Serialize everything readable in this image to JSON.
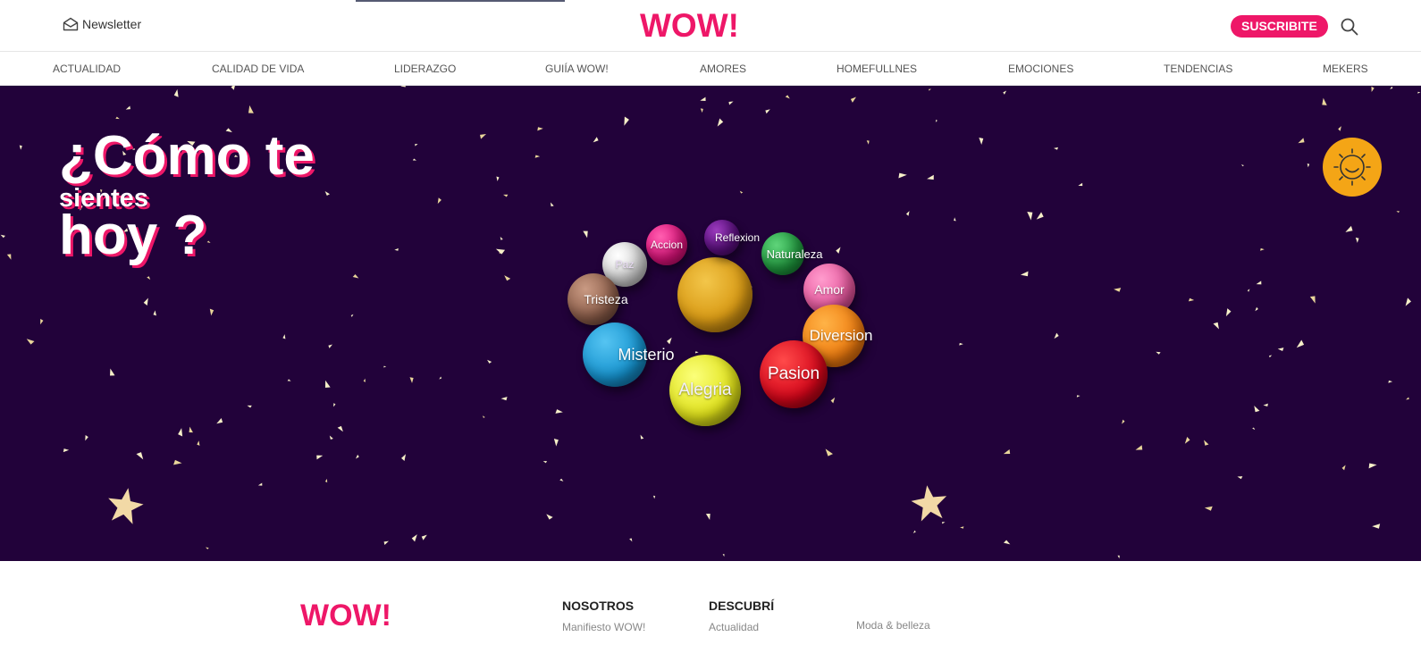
{
  "header": {
    "newsletter_label": "Newsletter",
    "logo": "WOW!",
    "subscribe_label": "SUSCRIBITE"
  },
  "nav": {
    "items": [
      "ACTUALIDAD",
      "CALIDAD DE VIDA",
      "LIDERAZGO",
      "GUIíA WOW!",
      "AMORES",
      "HOMEFULLNES",
      "EMOCIONES",
      "TENDENCIAS",
      "MEKERS"
    ]
  },
  "hero": {
    "line1": "¿Cómo te",
    "line2": "sientes",
    "line3": "hoy ?",
    "emotions": [
      "Accion",
      "Reflexion",
      "Paz",
      "Naturaleza",
      "Amor",
      "Tristeza",
      "Misterio",
      "Diversion",
      "Pasion",
      "Alegria"
    ]
  },
  "footer": {
    "logo": "WOW!",
    "col1_title": "NOSOTROS",
    "col1_links": [
      "Manifiesto WOW!"
    ],
    "col2_title": "DESCUBRÍ",
    "col2_links": [
      "Actualidad"
    ],
    "col3_links": [
      "Moda & belleza"
    ]
  },
  "colors": {
    "brand_pink": "#ee1768",
    "hero_bg": "#22023a",
    "sun_yellow": "#f4a516"
  },
  "icons": {
    "newsletter": "envelope-icon",
    "search": "magnifier-icon",
    "mood": "smiling-sun-icon"
  }
}
